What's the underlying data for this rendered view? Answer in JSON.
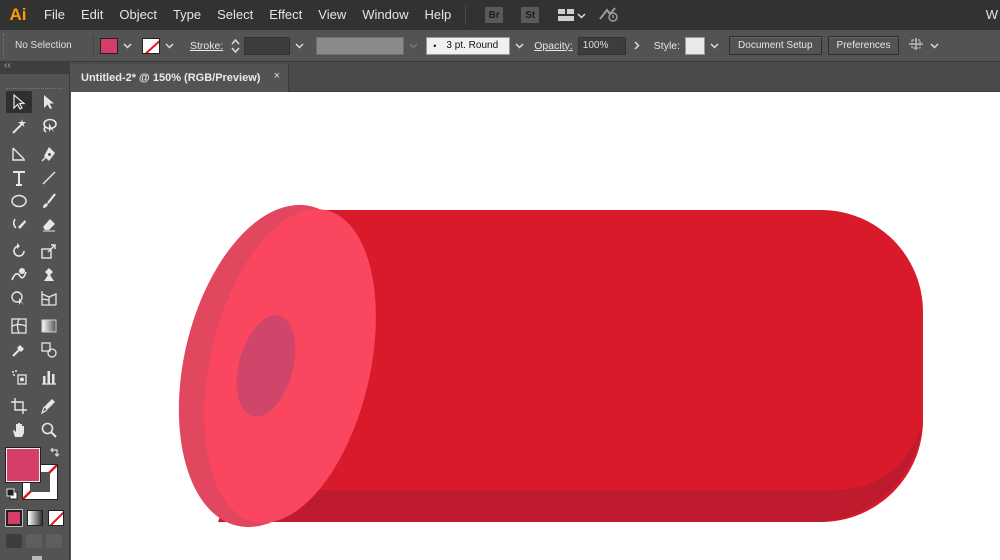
{
  "app": {
    "logo": "Ai"
  },
  "menu": {
    "items": [
      "File",
      "Edit",
      "Object",
      "Type",
      "Select",
      "Effect",
      "View",
      "Window",
      "Help"
    ],
    "bridge": "Br",
    "stock": "St",
    "right_cutoff": "W"
  },
  "control_bar": {
    "selection": "No Selection",
    "fill_color": "#d63e69",
    "stroke_label": "Stroke:",
    "stroke_weight": "",
    "brush_value": "3 pt. Round",
    "opacity_label": "Opacity:",
    "opacity_value": "100%",
    "style_label": "Style:",
    "document_setup": "Document Setup",
    "preferences": "Preferences"
  },
  "document": {
    "tab_title": "Untitled-2* @ 150% (RGB/Preview)",
    "close_glyph": "×"
  },
  "tools": {
    "fill_color": "#d63e69",
    "icons": [
      "selection-tool-icon",
      "direct-selection-tool-icon",
      "magic-wand-tool-icon",
      "lasso-tool-icon",
      "line-segment-tool-icon",
      "pen-tool-icon",
      "type-tool-icon",
      "line-tool-icon",
      "ellipse-tool-icon",
      "paintbrush-tool-icon",
      "shaper-tool-icon",
      "eraser-tool-icon",
      "rotate-tool-icon",
      "scale-tool-icon",
      "warp-tool-icon",
      "puppet-warp-tool-icon",
      "shape-builder-tool-icon",
      "perspective-grid-tool-icon",
      "mesh-tool-icon",
      "gradient-tool-icon",
      "eyedropper-tool-icon",
      "blend-tool-icon",
      "symbol-sprayer-tool-icon",
      "column-graph-tool-icon",
      "artboard-tool-icon",
      "slice-tool-icon",
      "hand-tool-icon",
      "zoom-tool-icon"
    ]
  },
  "artwork": {
    "body_color": "#d91a2a",
    "shadow_color": "#bf1b2e",
    "cap_color": "#fa465e",
    "cap_edge_color": "#e1485f",
    "hole_color": "#d0466b"
  }
}
